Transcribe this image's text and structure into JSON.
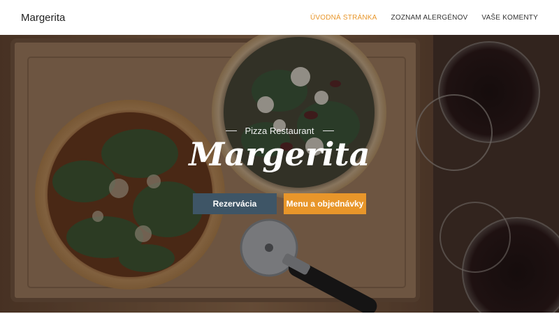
{
  "navbar": {
    "brand": "Margerita",
    "links": [
      {
        "label": "ÚVODNÁ STRÁNKA",
        "active": true
      },
      {
        "label": "ZOZNAM ALERGÉNOV",
        "active": false
      },
      {
        "label": "VAŠE KOMENTY",
        "active": false
      }
    ]
  },
  "hero": {
    "subtitle": "Pizza Restaurant",
    "title": "Margerita",
    "buttons": {
      "primary": "Rezervácia",
      "secondary": "Menu a objednávky"
    }
  },
  "colors": {
    "accent": "#e8962a",
    "primary_button": "#3e5566"
  }
}
